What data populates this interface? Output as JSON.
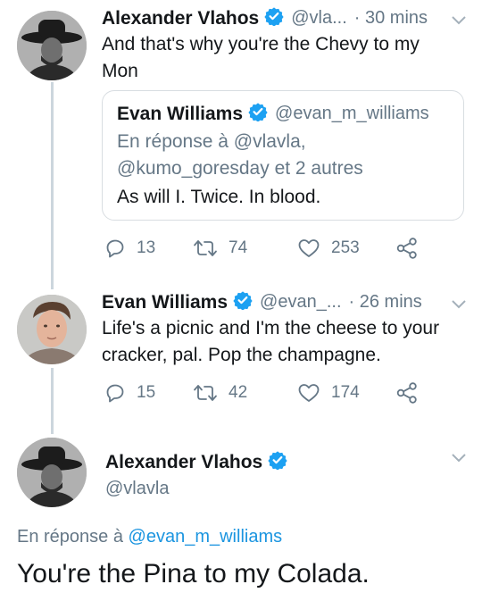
{
  "tweet1": {
    "author_name": "Alexander Vlahos",
    "author_handle": "@vla...",
    "time": "· 30 mins",
    "text": "And that's why you're the Chevy to my Mon",
    "quote": {
      "author_name": "Evan Williams",
      "author_handle": "@evan_m_williams",
      "reply_line1_prefix": "En réponse à ",
      "reply_line1_mention": "@vlavla,",
      "reply_line2": "@kumo_goresday et 2 autres",
      "text": "As will I. Twice. In blood."
    },
    "replies": "13",
    "retweets": "74",
    "likes": "253"
  },
  "tweet2": {
    "author_name": "Evan Williams",
    "author_handle": "@evan_...",
    "time": "· 26 mins",
    "text": "Life's a picnic and I'm the cheese to your cracker, pal. Pop the champagne.",
    "replies": "15",
    "retweets": "42",
    "likes": "174"
  },
  "tweet3": {
    "author_name": "Alexander Vlahos",
    "author_handle": "@vlavla",
    "reply_prefix": "En réponse à ",
    "reply_mention": "@evan_m_williams",
    "text": "You're the Pina to my Colada."
  },
  "icons": {
    "verified": "verified-badge-icon",
    "reply": "reply-icon",
    "retweet": "retweet-icon",
    "like": "heart-icon",
    "share": "share-icon",
    "caret": "chevron-down-icon"
  },
  "colors": {
    "verified": "#1da1f2",
    "muted": "#657786",
    "link": "#1b95e0",
    "thread_line": "#ccd6dd"
  }
}
